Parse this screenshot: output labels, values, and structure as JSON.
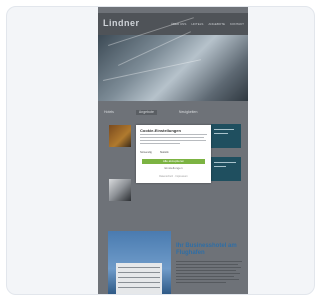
{
  "site": {
    "logo": "Lindner",
    "nav": [
      "ÜBER UNS",
      "HOTELS",
      "ANGEBOTE",
      "KONTAKT"
    ],
    "tabs": [
      "Hotels",
      "Angebote",
      "Neuigkeiten"
    ]
  },
  "cookie_banner": {
    "title": "Cookie-Einstellungen",
    "option_necessary": "Notwendig",
    "option_statistics": "Statistik",
    "accept_label": "Alle akzeptieren",
    "settings_label": "Einstellungen",
    "links": "Datenschutz · Impressum"
  },
  "article": {
    "title": "Ihr Businesshotel am Flughafen"
  },
  "colors": {
    "accent_green": "#7cb342",
    "teal": "#1f4f5f",
    "link_blue": "#2f6ea5"
  }
}
